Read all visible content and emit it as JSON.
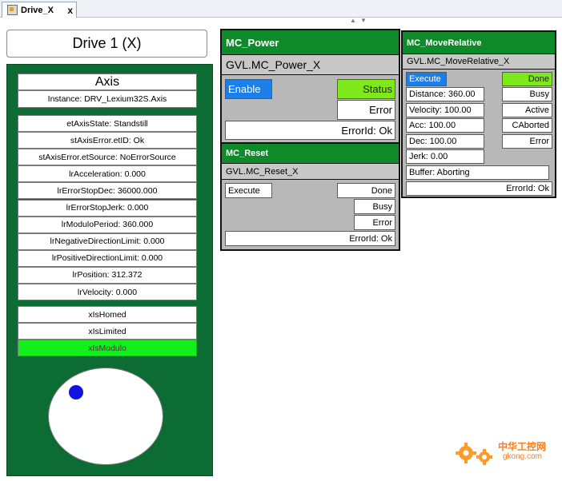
{
  "tab": {
    "title": "Drive_X",
    "close": "x"
  },
  "drive": {
    "title": "Drive 1 (X)"
  },
  "axis": {
    "title": "Axis",
    "instance": "Instance: DRV_Lexium32S.Axis",
    "values": [
      "etAxisState: Standstill",
      "stAxisError.etID: Ok",
      "stAxisError.etSource: NoErrorSource",
      "lrAcceleration: 0.000",
      "lrErrorStopDec: 36000.000",
      "lrErrorStopJerk: 0.000",
      "lrModuloPeriod: 360.000",
      "lrNegativeDirectionLimit: 0.000",
      "lrPositiveDirectionLimit: 0.000",
      "lrPosition: 312.372",
      "lrVelocity: 0.000"
    ],
    "flags": [
      "xIsHomed",
      "xIsLimited",
      "xIsModulo"
    ],
    "flag_states": [
      false,
      false,
      true
    ]
  },
  "mc_power": {
    "title": "MC_Power",
    "instance": "GVL.MC_Power_X",
    "enable": "Enable",
    "status": "Status",
    "error": "Error",
    "errorid": "ErrorId: Ok"
  },
  "mc_reset": {
    "title": "MC_Reset",
    "instance": "GVL.MC_Reset_X",
    "execute": "Execute",
    "done": "Done",
    "busy": "Busy",
    "error": "Error",
    "errorid": "ErrorId: Ok"
  },
  "mc_moverel": {
    "title": "MC_MoveRelative",
    "instance": "GVL.MC_MoveRelative_X",
    "execute": "Execute",
    "done": "Done",
    "distance": "Distance: 360.00",
    "busy": "Busy",
    "velocity": "Velocity: 100.00",
    "active": "Active",
    "acc": "Acc: 100.00",
    "caborted": "CAborted",
    "dec": "Dec: 100.00",
    "error": "Error",
    "jerk": "Jerk: 0.00",
    "buffer": "Buffer: Aborting",
    "errorid": "ErrorId: Ok"
  },
  "colors": {
    "panel_green": "#0d6b34",
    "header_green": "#0f8a2a",
    "active_blue": "#1c7fe8",
    "true_lime": "#7ee81a",
    "flag_green": "#12f01a",
    "dot_blue": "#1212e0"
  },
  "watermark": {
    "cn": "中华工控网",
    "url": "gkong.com"
  }
}
